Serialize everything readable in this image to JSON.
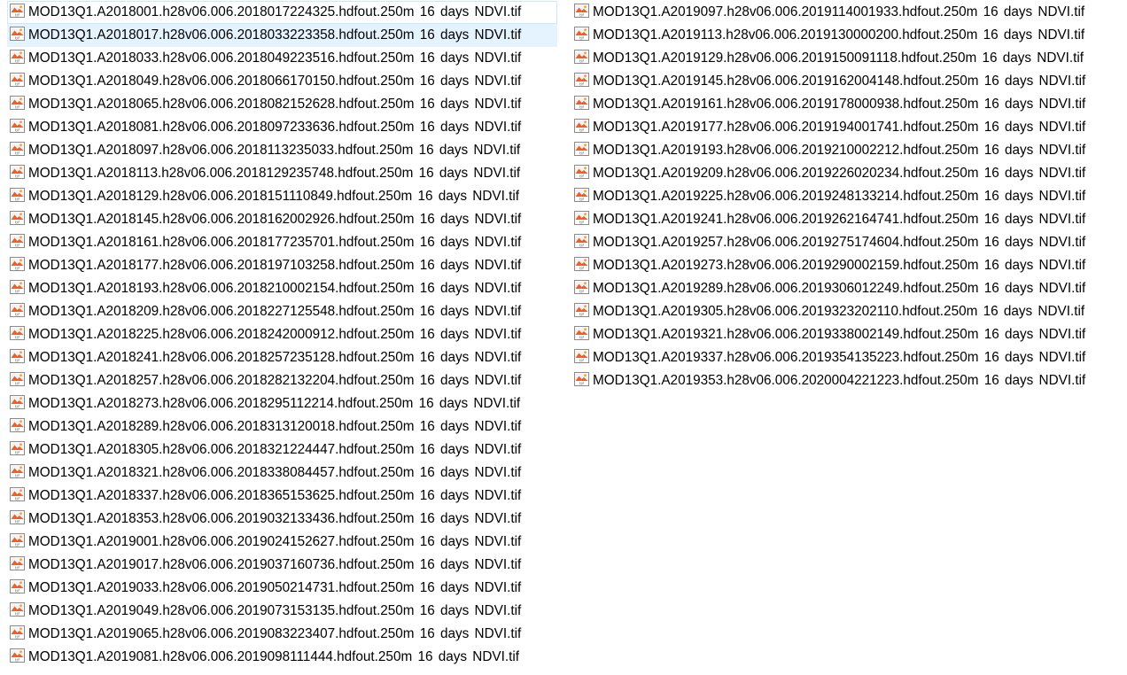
{
  "column1": [
    "MOD13Q1.A2018001.h28v06.006.2018017224325.hdfout.250m 16 days NDVI.tif",
    "MOD13Q1.A2018017.h28v06.006.2018033223358.hdfout.250m 16 days NDVI.tif",
    "MOD13Q1.A2018033.h28v06.006.2018049223516.hdfout.250m 16 days NDVI.tif",
    "MOD13Q1.A2018049.h28v06.006.2018066170150.hdfout.250m 16 days NDVI.tif",
    "MOD13Q1.A2018065.h28v06.006.2018082152628.hdfout.250m 16 days NDVI.tif",
    "MOD13Q1.A2018081.h28v06.006.2018097233636.hdfout.250m 16 days NDVI.tif",
    "MOD13Q1.A2018097.h28v06.006.2018113235033.hdfout.250m 16 days NDVI.tif",
    "MOD13Q1.A2018113.h28v06.006.2018129235748.hdfout.250m 16 days NDVI.tif",
    "MOD13Q1.A2018129.h28v06.006.2018151110849.hdfout.250m 16 days NDVI.tif",
    "MOD13Q1.A2018145.h28v06.006.2018162002926.hdfout.250m 16 days NDVI.tif",
    "MOD13Q1.A2018161.h28v06.006.2018177235701.hdfout.250m 16 days NDVI.tif",
    "MOD13Q1.A2018177.h28v06.006.2018197103258.hdfout.250m 16 days NDVI.tif",
    "MOD13Q1.A2018193.h28v06.006.2018210002154.hdfout.250m 16 days NDVI.tif",
    "MOD13Q1.A2018209.h28v06.006.2018227125548.hdfout.250m 16 days NDVI.tif",
    "MOD13Q1.A2018225.h28v06.006.2018242000912.hdfout.250m 16 days NDVI.tif",
    "MOD13Q1.A2018241.h28v06.006.2018257235128.hdfout.250m 16 days NDVI.tif",
    "MOD13Q1.A2018257.h28v06.006.2018282132204.hdfout.250m 16 days NDVI.tif",
    "MOD13Q1.A2018273.h28v06.006.2018295112214.hdfout.250m 16 days NDVI.tif",
    "MOD13Q1.A2018289.h28v06.006.2018313120018.hdfout.250m 16 days NDVI.tif",
    "MOD13Q1.A2018305.h28v06.006.2018321224447.hdfout.250m 16 days NDVI.tif",
    "MOD13Q1.A2018321.h28v06.006.2018338084457.hdfout.250m 16 days NDVI.tif",
    "MOD13Q1.A2018337.h28v06.006.2018365153625.hdfout.250m 16 days NDVI.tif",
    "MOD13Q1.A2018353.h28v06.006.2019032133436.hdfout.250m 16 days NDVI.tif",
    "MOD13Q1.A2019001.h28v06.006.2019024152627.hdfout.250m 16 days NDVI.tif",
    "MOD13Q1.A2019017.h28v06.006.2019037160736.hdfout.250m 16 days NDVI.tif",
    "MOD13Q1.A2019033.h28v06.006.2019050214731.hdfout.250m 16 days NDVI.tif",
    "MOD13Q1.A2019049.h28v06.006.2019073153135.hdfout.250m 16 days NDVI.tif",
    "MOD13Q1.A2019065.h28v06.006.2019083223407.hdfout.250m 16 days NDVI.tif",
    "MOD13Q1.A2019081.h28v06.006.2019098111444.hdfout.250m 16 days NDVI.tif"
  ],
  "column2": [
    "MOD13Q1.A2019097.h28v06.006.2019114001933.hdfout.250m 16 days NDVI.tif",
    "MOD13Q1.A2019113.h28v06.006.2019130000200.hdfout.250m 16 days NDVI.tif",
    "MOD13Q1.A2019129.h28v06.006.2019150091118.hdfout.250m 16 days NDVI.tif",
    "MOD13Q1.A2019145.h28v06.006.2019162004148.hdfout.250m 16 days NDVI.tif",
    "MOD13Q1.A2019161.h28v06.006.2019178000938.hdfout.250m 16 days NDVI.tif",
    "MOD13Q1.A2019177.h28v06.006.2019194001741.hdfout.250m 16 days NDVI.tif",
    "MOD13Q1.A2019193.h28v06.006.2019210002212.hdfout.250m 16 days NDVI.tif",
    "MOD13Q1.A2019209.h28v06.006.2019226020234.hdfout.250m 16 days NDVI.tif",
    "MOD13Q1.A2019225.h28v06.006.2019248133214.hdfout.250m 16 days NDVI.tif",
    "MOD13Q1.A2019241.h28v06.006.2019262164741.hdfout.250m 16 days NDVI.tif",
    "MOD13Q1.A2019257.h28v06.006.2019275174604.hdfout.250m 16 days NDVI.tif",
    "MOD13Q1.A2019273.h28v06.006.2019290002159.hdfout.250m 16 days NDVI.tif",
    "MOD13Q1.A2019289.h28v06.006.2019306012249.hdfout.250m 16 days NDVI.tif",
    "MOD13Q1.A2019305.h28v06.006.2019323202110.hdfout.250m 16 days NDVI.tif",
    "MOD13Q1.A2019321.h28v06.006.2019338002149.hdfout.250m 16 days NDVI.tif",
    "MOD13Q1.A2019337.h28v06.006.2019354135223.hdfout.250m 16 days NDVI.tif",
    "MOD13Q1.A2019353.h28v06.006.2020004221223.hdfout.250m 16 days NDVI.tif"
  ],
  "icon": "tif-image-file-icon",
  "colors": {
    "hover_background": "#e5f3ff",
    "focus_outline": "#cce8ff",
    "icon_accent": "#e8612c"
  }
}
